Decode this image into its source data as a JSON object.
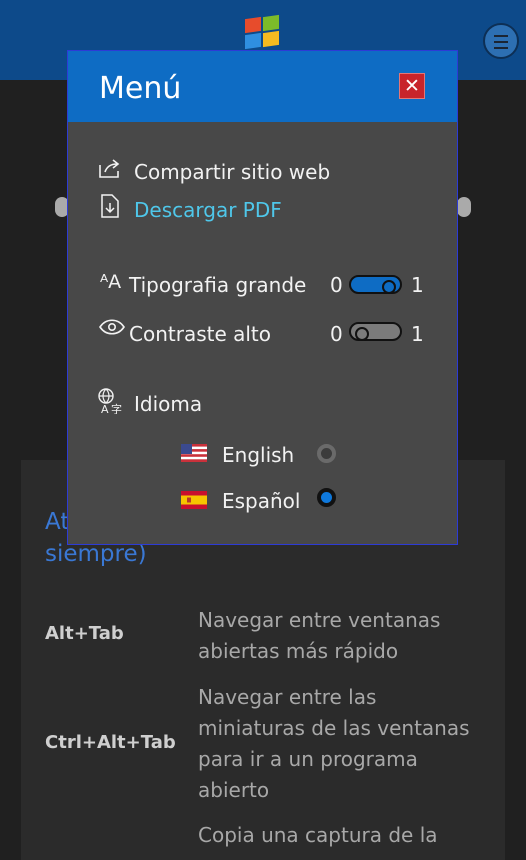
{
  "menu": {
    "title": "Menú",
    "close_label": "✕",
    "share_label": "Compartir sitio web",
    "download_label": "Descargar PDF",
    "large_font": {
      "label": "Tipografia grande",
      "off": "0",
      "on": "1",
      "value": 1
    },
    "high_contrast": {
      "label": "Contraste alto",
      "off": "0",
      "on": "1",
      "value": 0
    },
    "language_label": "Idioma",
    "languages": [
      {
        "label": "English",
        "selected": false
      },
      {
        "label": "Español",
        "selected": true
      }
    ]
  },
  "page": {
    "card_title": "Atajos de teclado (para usar siempre)",
    "shortcuts": [
      {
        "keys": "Alt+Tab",
        "description": "Navegar entre ventanas abiertas más rápido"
      },
      {
        "keys": "Ctrl+Alt+Tab",
        "description": "Navegar entre las miniaturas de las ventanas para ir a un programa abierto"
      },
      {
        "keys": "",
        "description": "Copia una captura de la"
      }
    ]
  },
  "colors": {
    "header": "#0d4a8a",
    "menu_head": "#0e6cc4",
    "accent_link": "#4fc7ea",
    "toggle_on": "#0e6cc4",
    "toggle_off": "#7b7b7b"
  }
}
